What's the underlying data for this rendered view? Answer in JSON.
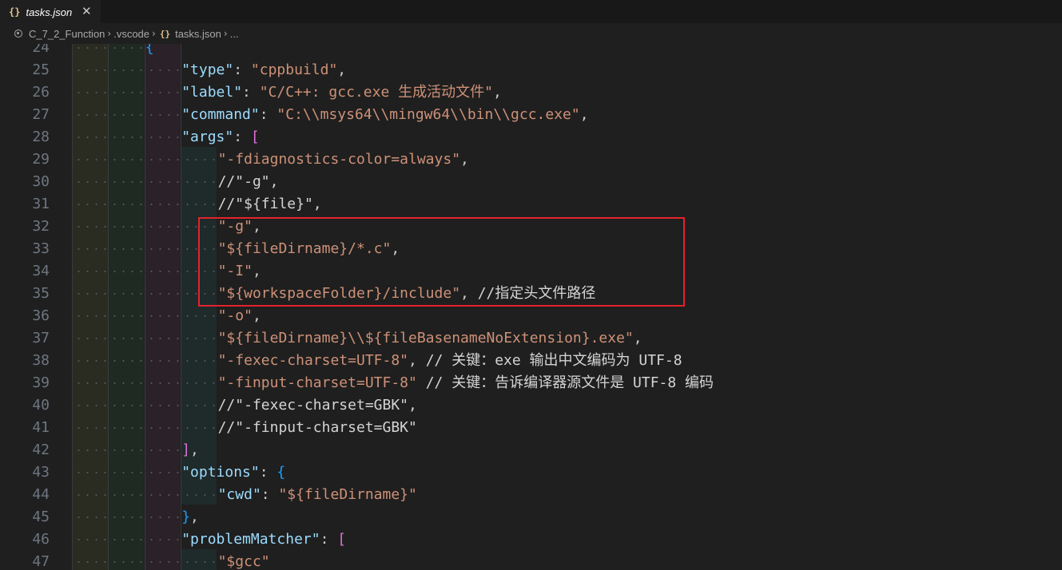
{
  "tab": {
    "icon": "braces-json-icon",
    "label": "tasks.json",
    "close_icon": "close-icon"
  },
  "breadcrumb": {
    "items": [
      "C_7_2_Function",
      ".vscode",
      "tasks.json",
      "..."
    ],
    "separator": ">"
  },
  "colors": {
    "background": "#1f1f1f",
    "key": "#9cdcfe",
    "string": "#ce9178",
    "line_number": "#6e7681",
    "highlight_box": "#e3232c"
  },
  "editor": {
    "lines": [
      {
        "num": "24",
        "indent": 2,
        "tokens": [
          [
            "b3",
            "{"
          ]
        ]
      },
      {
        "num": "25",
        "indent": 3,
        "tokens": [
          [
            "k",
            "\"type\""
          ],
          [
            "p",
            ": "
          ],
          [
            "s",
            "\"cppbuild\""
          ],
          [
            "p",
            ","
          ]
        ]
      },
      {
        "num": "26",
        "indent": 3,
        "tokens": [
          [
            "k",
            "\"label\""
          ],
          [
            "p",
            ": "
          ],
          [
            "s",
            "\"C/C++: gcc.exe 生成活动文件\""
          ],
          [
            "p",
            ","
          ]
        ]
      },
      {
        "num": "27",
        "indent": 3,
        "tokens": [
          [
            "k",
            "\"command\""
          ],
          [
            "p",
            ": "
          ],
          [
            "s",
            "\"C:\\\\msys64\\\\mingw64\\\\bin\\\\gcc.exe\""
          ],
          [
            "p",
            ","
          ]
        ]
      },
      {
        "num": "28",
        "indent": 3,
        "tokens": [
          [
            "k",
            "\"args\""
          ],
          [
            "p",
            ": "
          ],
          [
            "b2",
            "["
          ]
        ]
      },
      {
        "num": "29",
        "indent": 4,
        "tokens": [
          [
            "s",
            "\"-fdiagnostics-color=always\""
          ],
          [
            "p",
            ","
          ]
        ]
      },
      {
        "num": "30",
        "indent": 4,
        "tokens": [
          [
            "c",
            "//\"-g\","
          ]
        ]
      },
      {
        "num": "31",
        "indent": 4,
        "tokens": [
          [
            "c",
            "//\"${file}\","
          ]
        ]
      },
      {
        "num": "32",
        "indent": 4,
        "tokens": [
          [
            "s",
            "\"-g\""
          ],
          [
            "p",
            ","
          ]
        ]
      },
      {
        "num": "33",
        "indent": 4,
        "tokens": [
          [
            "s",
            "\"${fileDirname}/*.c\""
          ],
          [
            "p",
            ","
          ]
        ]
      },
      {
        "num": "34",
        "indent": 4,
        "tokens": [
          [
            "s",
            "\"-I\""
          ],
          [
            "p",
            ","
          ]
        ]
      },
      {
        "num": "35",
        "indent": 4,
        "tokens": [
          [
            "s",
            "\"${workspaceFolder}/include\""
          ],
          [
            "p",
            ", "
          ],
          [
            "c",
            "//指定头文件路径"
          ]
        ]
      },
      {
        "num": "36",
        "indent": 4,
        "tokens": [
          [
            "s",
            "\"-o\""
          ],
          [
            "p",
            ","
          ]
        ]
      },
      {
        "num": "37",
        "indent": 4,
        "tokens": [
          [
            "s",
            "\"${fileDirname}\\\\${fileBasenameNoExtension}.exe\""
          ],
          [
            "p",
            ","
          ]
        ]
      },
      {
        "num": "38",
        "indent": 4,
        "tokens": [
          [
            "s",
            "\"-fexec-charset=UTF-8\""
          ],
          [
            "p",
            ", "
          ],
          [
            "c",
            "// 关键：exe 输出中文编码为 UTF-8"
          ]
        ]
      },
      {
        "num": "39",
        "indent": 4,
        "tokens": [
          [
            "s",
            "\"-finput-charset=UTF-8\""
          ],
          [
            "p",
            " "
          ],
          [
            "c",
            "// 关键：告诉编译器源文件是 UTF-8 编码"
          ]
        ]
      },
      {
        "num": "40",
        "indent": 4,
        "tokens": [
          [
            "c",
            "//\"-fexec-charset=GBK\","
          ]
        ]
      },
      {
        "num": "41",
        "indent": 4,
        "tokens": [
          [
            "c",
            "//\"-finput-charset=GBK\""
          ]
        ]
      },
      {
        "num": "42",
        "indent": 3,
        "tokens": [
          [
            "b2",
            "]"
          ],
          [
            "p",
            ","
          ]
        ]
      },
      {
        "num": "43",
        "indent": 3,
        "tokens": [
          [
            "k",
            "\"options\""
          ],
          [
            "p",
            ": "
          ],
          [
            "b3",
            "{"
          ]
        ]
      },
      {
        "num": "44",
        "indent": 4,
        "tokens": [
          [
            "k",
            "\"cwd\""
          ],
          [
            "p",
            ": "
          ],
          [
            "s",
            "\"${fileDirname}\""
          ]
        ]
      },
      {
        "num": "45",
        "indent": 3,
        "tokens": [
          [
            "b3",
            "}"
          ],
          [
            "p",
            ","
          ]
        ]
      },
      {
        "num": "46",
        "indent": 3,
        "tokens": [
          [
            "k",
            "\"problemMatcher\""
          ],
          [
            "p",
            ": "
          ],
          [
            "b2",
            "["
          ]
        ]
      },
      {
        "num": "47",
        "indent": 4,
        "tokens": [
          [
            "s",
            "\"$gcc\""
          ]
        ]
      }
    ]
  }
}
